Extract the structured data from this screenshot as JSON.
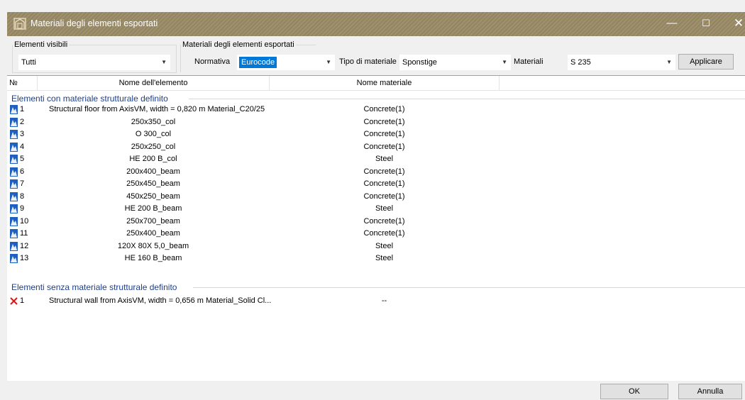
{
  "window": {
    "title": "Materiali degli elementi esportati",
    "controls": {
      "minimize": "—",
      "maximize": "☐",
      "close": "✕"
    },
    "title_bar_color": "#9a8a66"
  },
  "filters": {
    "visible_group_label": "Elementi visibili",
    "visible_value": "Tutti",
    "materials_group_label": "Materiali degli elementi esportati",
    "normativa_label": "Normativa",
    "normativa_value": "Eurocode",
    "tipo_label": "Tipo di materiale",
    "tipo_value": "Sponstige",
    "materiali_label": "Materiali",
    "materiali_value": "S 235",
    "apply_label": "Applicare"
  },
  "grid": {
    "columns": {
      "no": "№",
      "name": "Nome dell'elemento",
      "material": "Nome materiale"
    },
    "group_defined": {
      "title": "Elementi con materiale strutturale definito",
      "rows": [
        {
          "no": "1",
          "name": "Structural floor from AxisVM, width = 0,820 m Material_C20/25",
          "material": "Concrete(1)"
        },
        {
          "no": "2",
          "name": "250x350_col",
          "material": "Concrete(1)"
        },
        {
          "no": "3",
          "name": "O 300_col",
          "material": "Concrete(1)"
        },
        {
          "no": "4",
          "name": "250x250_col",
          "material": "Concrete(1)"
        },
        {
          "no": "5",
          "name": "HE  200 B_col",
          "material": "Steel"
        },
        {
          "no": "6",
          "name": "200x400_beam",
          "material": "Concrete(1)"
        },
        {
          "no": "7",
          "name": "250x450_beam",
          "material": "Concrete(1)"
        },
        {
          "no": "8",
          "name": "450x250_beam",
          "material": "Concrete(1)"
        },
        {
          "no": "9",
          "name": "HE  200 B_beam",
          "material": "Steel"
        },
        {
          "no": "10",
          "name": "250x700_beam",
          "material": "Concrete(1)"
        },
        {
          "no": "11",
          "name": "250x400_beam",
          "material": "Concrete(1)"
        },
        {
          "no": "12",
          "name": "120X 80X 5,0_beam",
          "material": "Steel"
        },
        {
          "no": "13",
          "name": "HE  160 B_beam",
          "material": "Steel"
        }
      ]
    },
    "group_undefined": {
      "title": "Elementi senza materiale strutturale definito",
      "rows": [
        {
          "no": "1",
          "name": "Structural wall from AxisVM, width = 0,656 m Material_Solid Cl...",
          "material": "--"
        }
      ]
    }
  },
  "footer": {
    "ok_label": "OK",
    "cancel_label": "Annulla"
  },
  "colors": {
    "accent": "#0078d7",
    "group_text": "#1e3f8a",
    "ok_icon": "#1f5fbf",
    "error_icon": "#d11a1a"
  }
}
